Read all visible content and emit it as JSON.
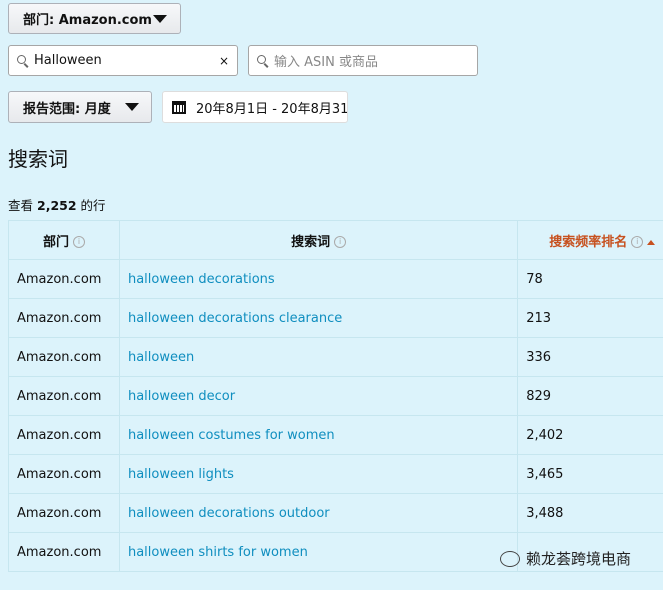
{
  "department_selector": {
    "label": "部门: Amazon.com"
  },
  "keyword_search": {
    "value": "Halloween",
    "clear": "×"
  },
  "asin_search": {
    "placeholder": "输入 ASIN 或商品"
  },
  "report_range": {
    "label": "报告范围: 月度"
  },
  "date_range": {
    "value": "20年8月1日 - 20年8月31"
  },
  "page_title": "搜索词",
  "row_count": {
    "prefix": "查看",
    "count": "2,252",
    "suffix": "的行"
  },
  "table": {
    "columns": [
      "部门",
      "搜索词",
      "搜索频率排名"
    ],
    "info": "i",
    "rows": [
      {
        "department": "Amazon.com",
        "term": "halloween decorations",
        "rank": "78"
      },
      {
        "department": "Amazon.com",
        "term": "halloween decorations clearance",
        "rank": "213"
      },
      {
        "department": "Amazon.com",
        "term": "halloween",
        "rank": "336"
      },
      {
        "department": "Amazon.com",
        "term": "halloween decor",
        "rank": "829"
      },
      {
        "department": "Amazon.com",
        "term": "halloween costumes for women",
        "rank": "2,402"
      },
      {
        "department": "Amazon.com",
        "term": "halloween lights",
        "rank": "3,465"
      },
      {
        "department": "Amazon.com",
        "term": "halloween decorations outdoor",
        "rank": "3,488"
      },
      {
        "department": "Amazon.com",
        "term": "halloween shirts for women",
        "rank": ""
      }
    ]
  },
  "watermark": "赖龙荟跨境电商",
  "colors": {
    "link": "#0f8ebf",
    "sorted_header": "#c7511f",
    "background": "#dcf3fb"
  }
}
